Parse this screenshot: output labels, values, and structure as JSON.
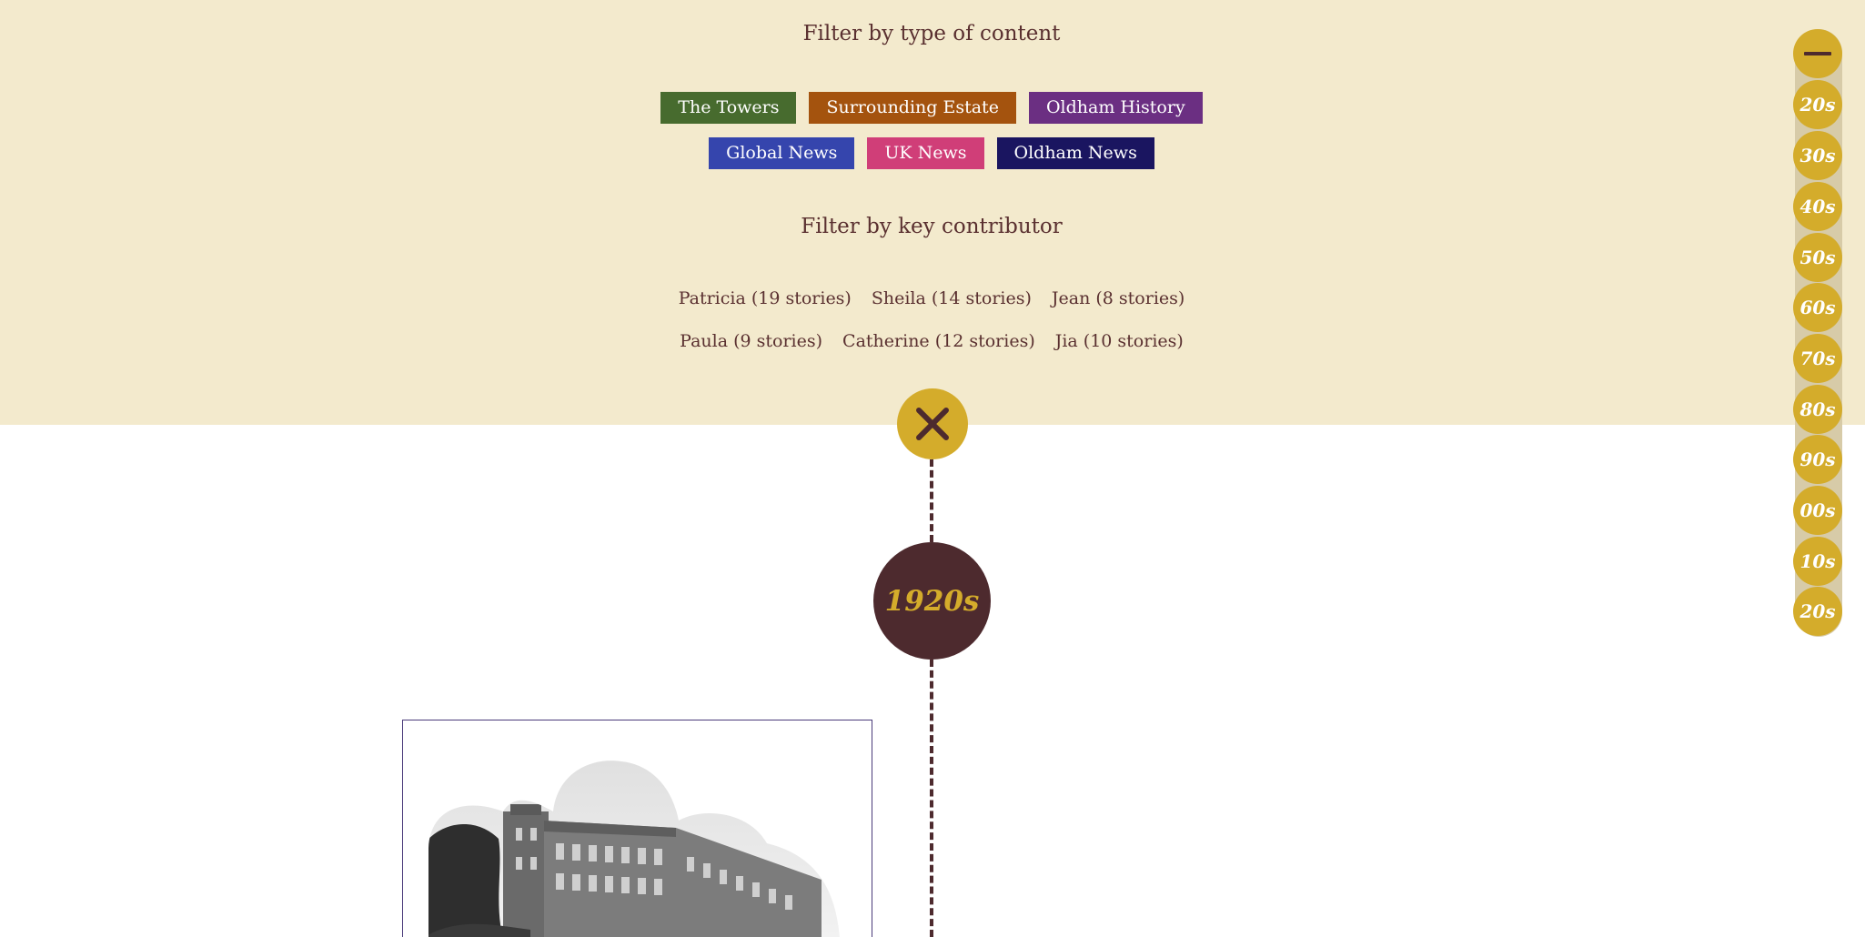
{
  "filters": {
    "content_heading": "Filter by type of content",
    "content_types": [
      {
        "label": "The Towers",
        "color": "#476b2e"
      },
      {
        "label": "Surrounding Estate",
        "color": "#a4530e"
      },
      {
        "label": "Oldham History",
        "color": "#6b2f82"
      },
      {
        "label": "Global News",
        "color": "#3545ad"
      },
      {
        "label": "UK News",
        "color": "#d03e78"
      },
      {
        "label": "Oldham News",
        "color": "#1a1560"
      }
    ],
    "contributor_heading": "Filter by key contributor",
    "contributors": [
      "Patricia (19 stories)",
      "Sheila (14 stories)",
      "Jean (8 stories)",
      "Paula (9 stories)",
      "Catherine (12 stories)",
      "Jia (10 stories)"
    ]
  },
  "close_icon": "close-x-icon",
  "timeline": {
    "current_decade": "1920s"
  },
  "decade_nav": {
    "collapse_icon": "minus-icon",
    "decades": [
      "20s",
      "30s",
      "40s",
      "50s",
      "60s",
      "70s",
      "80s",
      "90s",
      "00s",
      "10s",
      "20s"
    ]
  },
  "colors": {
    "panel_bg": "#f3eacd",
    "accent_gold": "#d4ac2b",
    "timeline_brown": "#4d2a2e"
  }
}
